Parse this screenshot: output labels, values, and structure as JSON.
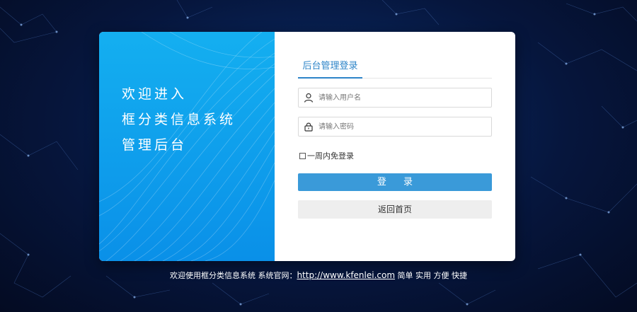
{
  "welcome": {
    "line1": "欢迎进入",
    "line2": "框分类信息系统",
    "line3": "管理后台"
  },
  "login": {
    "tab_label": "后台管理登录",
    "username_placeholder": "请输入用户名",
    "password_placeholder": "请输入密码",
    "remember_label": "一周内免登录",
    "login_button": "登 录",
    "home_button": "返回首页"
  },
  "footer": {
    "prefix": "欢迎使用框分类信息系统 系统官网：",
    "link": "http://www.kfenlei.com",
    "suffix": " 简单 实用 方便 快捷"
  },
  "icons": {
    "user": "user-icon",
    "lock": "lock-icon"
  },
  "colors": {
    "accent": "#3a9ad9",
    "panel_blue": "#0a90e8",
    "background": "#06163d"
  }
}
